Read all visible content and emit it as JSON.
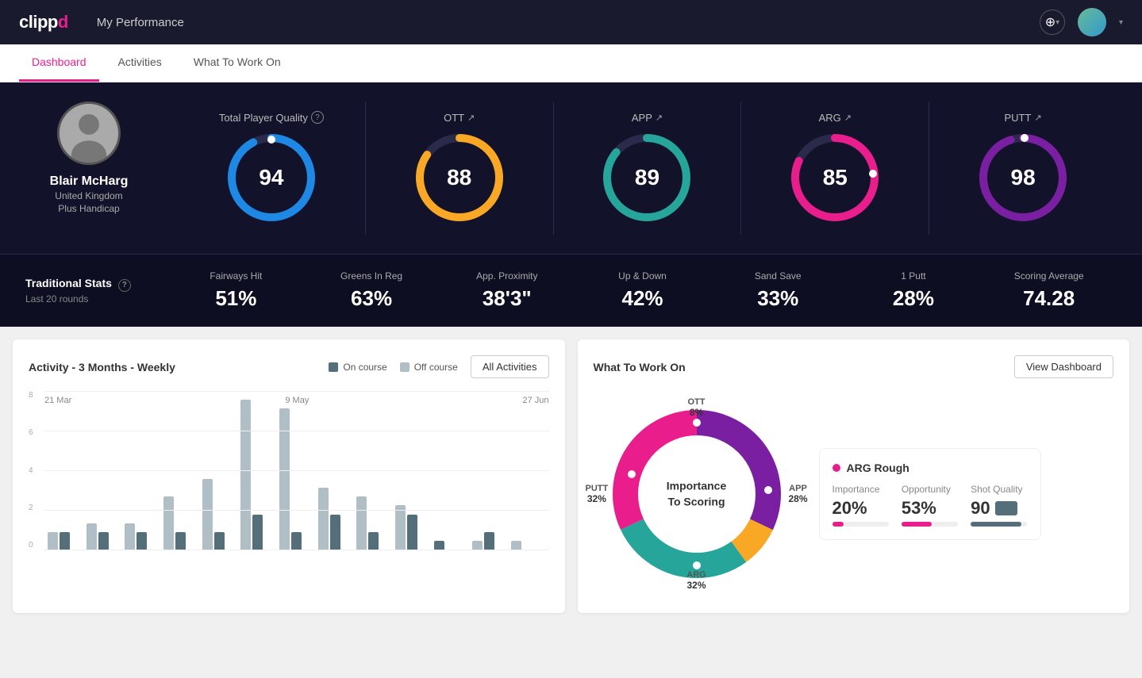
{
  "app": {
    "logo": "clipp",
    "logo_d": "d",
    "title": "My Performance"
  },
  "tabs": [
    {
      "id": "dashboard",
      "label": "Dashboard",
      "active": true
    },
    {
      "id": "activities",
      "label": "Activities",
      "active": false
    },
    {
      "id": "what-to-work-on",
      "label": "What To Work On",
      "active": false
    }
  ],
  "player": {
    "name": "Blair McHarg",
    "country": "United Kingdom",
    "handicap": "Plus Handicap"
  },
  "total_quality": {
    "label": "Total Player Quality",
    "value": 94,
    "color": "#1e88e5"
  },
  "metrics": [
    {
      "id": "ott",
      "label": "OTT",
      "value": 88,
      "color": "#f9a825"
    },
    {
      "id": "app",
      "label": "APP",
      "value": 89,
      "color": "#26a69a"
    },
    {
      "id": "arg",
      "label": "ARG",
      "value": 85,
      "color": "#e91e8c"
    },
    {
      "id": "putt",
      "label": "PUTT",
      "value": 98,
      "color": "#7b1fa2"
    }
  ],
  "traditional_stats": {
    "label": "Traditional Stats",
    "sublabel": "Last 20 rounds",
    "items": [
      {
        "name": "Fairways Hit",
        "value": "51%"
      },
      {
        "name": "Greens In Reg",
        "value": "63%"
      },
      {
        "name": "App. Proximity",
        "value": "38'3\""
      },
      {
        "name": "Up & Down",
        "value": "42%"
      },
      {
        "name": "Sand Save",
        "value": "33%"
      },
      {
        "name": "1 Putt",
        "value": "28%"
      },
      {
        "name": "Scoring Average",
        "value": "74.28"
      }
    ]
  },
  "activity_chart": {
    "title": "Activity - 3 Months - Weekly",
    "legend": {
      "on_course": "On course",
      "off_course": "Off course"
    },
    "all_activities_btn": "All Activities",
    "x_labels": [
      "21 Mar",
      "9 May",
      "27 Jun"
    ],
    "y_labels": [
      "8",
      "6",
      "4",
      "2",
      "0"
    ],
    "bars": [
      {
        "on": 1,
        "off": 1
      },
      {
        "on": 1,
        "off": 1.5
      },
      {
        "on": 1,
        "off": 1.5
      },
      {
        "on": 1,
        "off": 3
      },
      {
        "on": 1,
        "off": 4
      },
      {
        "on": 2,
        "off": 8.5
      },
      {
        "on": 1,
        "off": 8
      },
      {
        "on": 2,
        "off": 3.5
      },
      {
        "on": 1,
        "off": 3
      },
      {
        "on": 2,
        "off": 2.5
      },
      {
        "on": 0.5,
        "off": 0
      },
      {
        "on": 1,
        "off": 0.5
      },
      {
        "on": 0,
        "off": 0.5
      }
    ]
  },
  "what_to_work_on": {
    "title": "What To Work On",
    "view_dashboard_btn": "View Dashboard",
    "donut": {
      "center_line1": "Importance",
      "center_line2": "To Scoring",
      "segments": [
        {
          "id": "ott",
          "label": "OTT",
          "pct": "8%",
          "value": 8,
          "color": "#f9a825"
        },
        {
          "id": "app",
          "label": "APP",
          "pct": "28%",
          "value": 28,
          "color": "#26a69a"
        },
        {
          "id": "arg",
          "label": "ARG",
          "pct": "32%",
          "value": 32,
          "color": "#e91e8c"
        },
        {
          "id": "putt",
          "label": "PUTT",
          "pct": "32%",
          "value": 32,
          "color": "#7b1fa2"
        }
      ]
    },
    "highlight_card": {
      "title": "ARG Rough",
      "stats": [
        {
          "label": "Importance",
          "value": "20%",
          "bar_pct": 20,
          "color": "#e91e8c"
        },
        {
          "label": "Opportunity",
          "value": "53%",
          "bar_pct": 53,
          "color": "#e91e8c"
        },
        {
          "label": "Shot Quality",
          "value": "90",
          "bar_pct": 90,
          "color": "#546e7a"
        }
      ]
    }
  }
}
